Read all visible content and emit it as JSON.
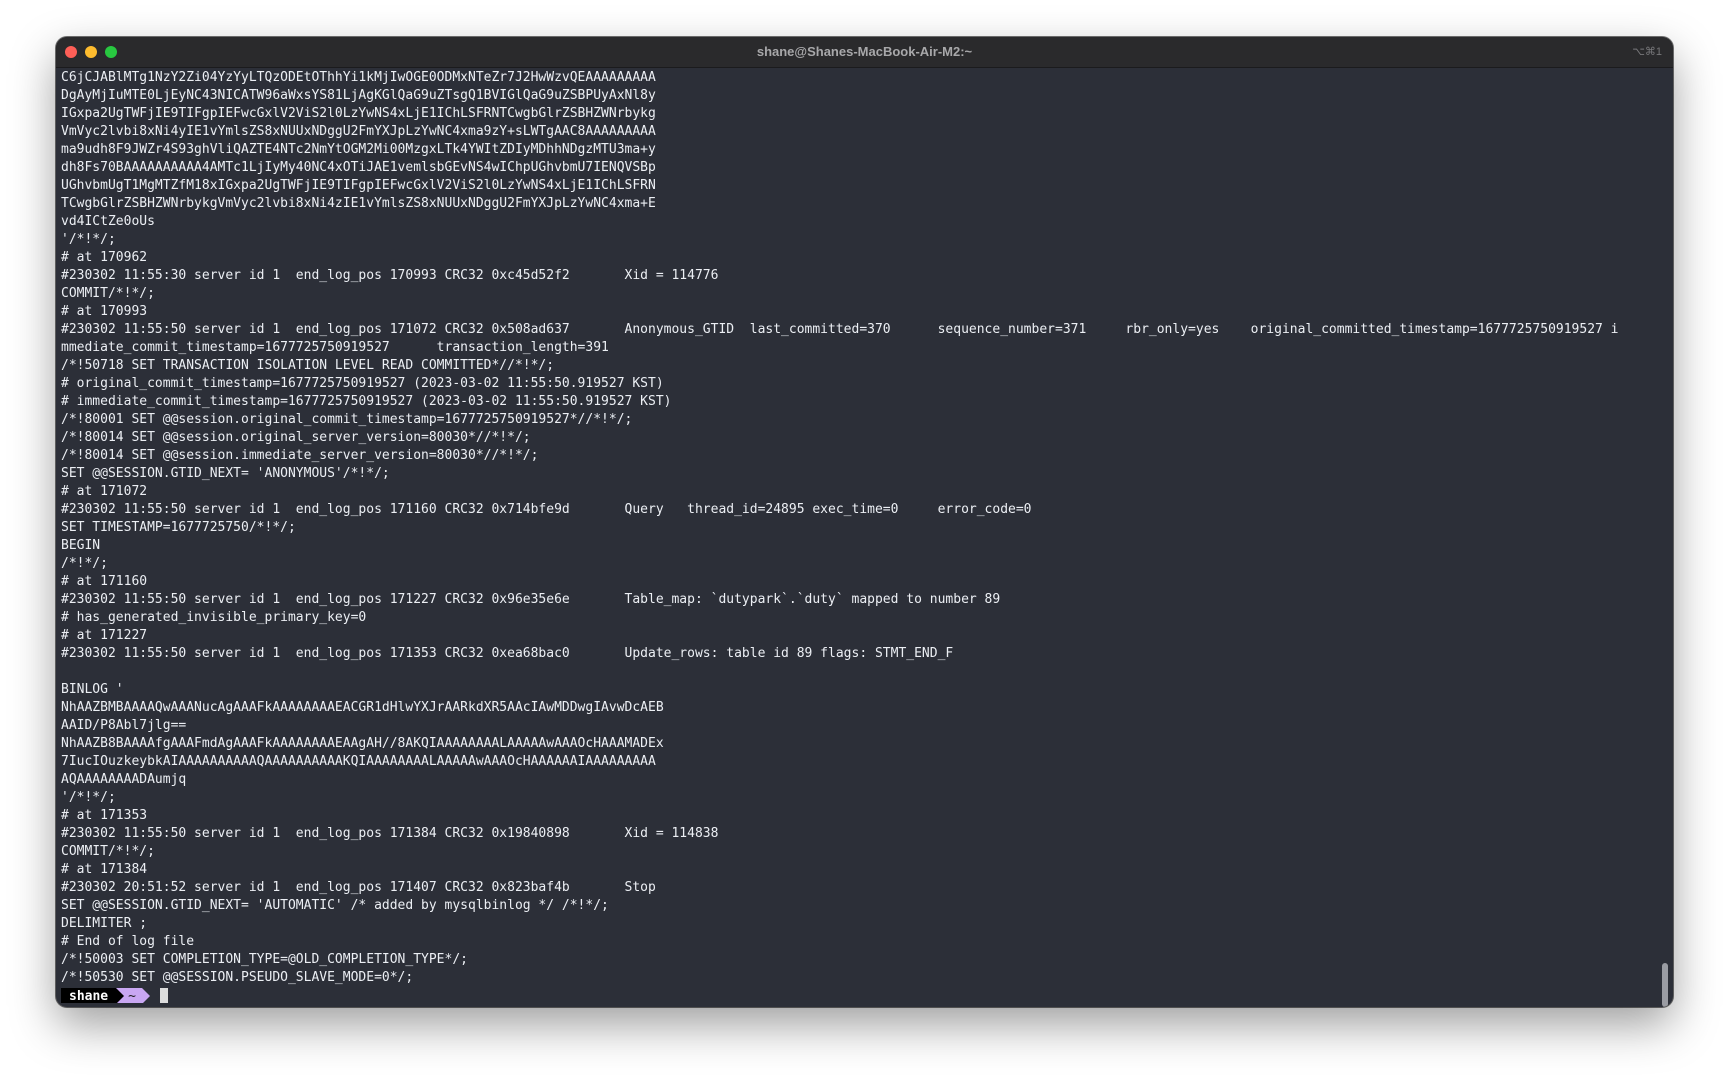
{
  "window": {
    "title": "shane@Shanes-MacBook-Air-M2:~",
    "shortcut": "⌥⌘1"
  },
  "terminal": {
    "lines": [
      "C6jCJABlMTg1NzY2Zi04YzYyLTQzODEtOThhYi1kMjIwOGE0ODMxNTeZr7J2HwWzvQEAAAAAAAAA",
      "DgAyMjIuMTE0LjEyNC43NICATW96aWxsYS81LjAgKGlQaG9uZTsgQ1BVIGlQaG9uZSBPUyAxNl8y",
      "IGxpa2UgTWFjIE9TIFgpIEFwcGxlV2ViS2l0LzYwNS4xLjE1IChLSFRNTCwgbGlrZSBHZWNrbykg",
      "VmVyc2lvbi8xNi4yIE1vYmlsZS8xNUUxNDggU2FmYXJpLzYwNC4xma9zY+sLWTgAAC8AAAAAAAAA",
      "ma9udh8F9JWZr4S93ghVliQAZTE4NTc2NmYtOGM2Mi00MzgxLTk4YWItZDIyMDhhNDgzMTU3ma+y",
      "dh8Fs70BAAAAAAAAAA4AMTc1LjIyMy40NC4xOTiJAE1vemlsbGEvNS4wIChpUGhvbmU7IENQVSBp",
      "UGhvbmUgT1MgMTZfM18xIGxpa2UgTWFjIE9TIFgpIEFwcGxlV2ViS2l0LzYwNS4xLjE1IChLSFRN",
      "TCwgbGlrZSBHZWNrbykgVmVyc2lvbi8xNi4zIE1vYmlsZS8xNUUxNDggU2FmYXJpLzYwNC4xma+E",
      "vd4ICtZe0oUs",
      "'/*!*/;",
      "# at 170962",
      "#230302 11:55:30 server id 1  end_log_pos 170993 CRC32 0xc45d52f2       Xid = 114776",
      "COMMIT/*!*/;",
      "# at 170993",
      "#230302 11:55:50 server id 1  end_log_pos 171072 CRC32 0x508ad637       Anonymous_GTID  last_committed=370      sequence_number=371     rbr_only=yes    original_committed_timestamp=1677725750919527 i",
      "mmediate_commit_timestamp=1677725750919527      transaction_length=391",
      "/*!50718 SET TRANSACTION ISOLATION LEVEL READ COMMITTED*//*!*/;",
      "# original_commit_timestamp=1677725750919527 (2023-03-02 11:55:50.919527 KST)",
      "# immediate_commit_timestamp=1677725750919527 (2023-03-02 11:55:50.919527 KST)",
      "/*!80001 SET @@session.original_commit_timestamp=1677725750919527*//*!*/;",
      "/*!80014 SET @@session.original_server_version=80030*//*!*/;",
      "/*!80014 SET @@session.immediate_server_version=80030*//*!*/;",
      "SET @@SESSION.GTID_NEXT= 'ANONYMOUS'/*!*/;",
      "# at 171072",
      "#230302 11:55:50 server id 1  end_log_pos 171160 CRC32 0x714bfe9d       Query   thread_id=24895 exec_time=0     error_code=0",
      "SET TIMESTAMP=1677725750/*!*/;",
      "BEGIN",
      "/*!*/;",
      "# at 171160",
      "#230302 11:55:50 server id 1  end_log_pos 171227 CRC32 0x96e35e6e       Table_map: `dutypark`.`duty` mapped to number 89",
      "# has_generated_invisible_primary_key=0",
      "# at 171227",
      "#230302 11:55:50 server id 1  end_log_pos 171353 CRC32 0xea68bac0       Update_rows: table id 89 flags: STMT_END_F",
      "",
      "BINLOG '",
      "NhAAZBMBAAAAQwAAANucAgAAAFkAAAAAAAAEACGR1dHlwYXJrAARkdXR5AAcIAwMDDwgIAvwDcAEB",
      "AAID/P8Abl7jlg==",
      "NhAAZB8BAAAAfgAAAFmdAgAAAFkAAAAAAAAEAAgAH//8AKQIAAAAAAAALAAAAAwAAAOcHAAAMADEx",
      "7IucIOuzkeybkAIAAAAAAAAAAQAAAAAAAAAAKQIAAAAAAAALAAAAAwAAAOcHAAAAAAIAAAAAAAAA",
      "AQAAAAAAAADAumjq",
      "'/*!*/;",
      "# at 171353",
      "#230302 11:55:50 server id 1  end_log_pos 171384 CRC32 0x19840898       Xid = 114838",
      "COMMIT/*!*/;",
      "# at 171384",
      "#230302 20:51:52 server id 1  end_log_pos 171407 CRC32 0x823baf4b       Stop",
      "SET @@SESSION.GTID_NEXT= 'AUTOMATIC' /* added by mysqlbinlog */ /*!*/;",
      "DELIMITER ;",
      "# End of log file",
      "/*!50003 SET COMPLETION_TYPE=@OLD_COMPLETION_TYPE*/;",
      "/*!50530 SET @@SESSION.PSEUDO_SLAVE_MODE=0*/;"
    ],
    "prompt": {
      "user": "shane",
      "dir": "~"
    }
  },
  "colors": {
    "terminal_bg": "#2c2f38",
    "text": "#eceff4",
    "prompt_user_bg": "#000000",
    "prompt_dir_bg": "#c9a7f2"
  }
}
